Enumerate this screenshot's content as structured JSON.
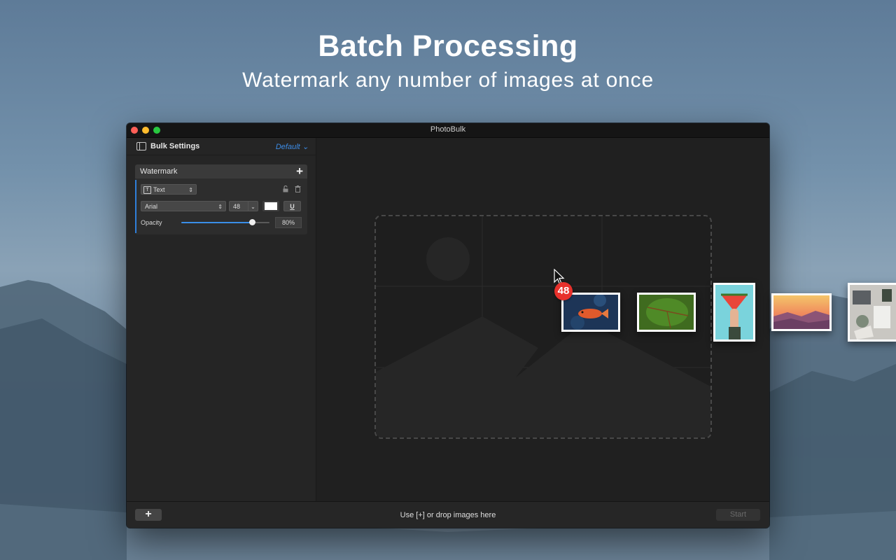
{
  "hero": {
    "title": "Batch Processing",
    "subtitle": "Watermark any number of images at once"
  },
  "window": {
    "title": "PhotoBulk",
    "traffic_colors": [
      "#fe5f57",
      "#febc2e",
      "#28c840"
    ]
  },
  "sidebar": {
    "title": "Bulk Settings",
    "preset": "Default",
    "sidebar_icon": "sidebar-toggle-icon"
  },
  "watermark_panel": {
    "title": "Watermark",
    "add_icon": "plus-icon",
    "type_select": "Text",
    "lock_icon": "lock-icon",
    "trash_icon": "trash-icon",
    "font_select": "Arial",
    "font_size": "48",
    "color_swatch": "#ffffff",
    "underline_label": "U",
    "opacity_label": "Opacity",
    "opacity_value": "80%",
    "opacity_fraction": 0.8
  },
  "footer": {
    "add_label": "+",
    "hint": "Use [+] or drop images here",
    "start_label": "Start"
  },
  "drag": {
    "count_badge": "48"
  },
  "accent_color": "#2f7fd9"
}
